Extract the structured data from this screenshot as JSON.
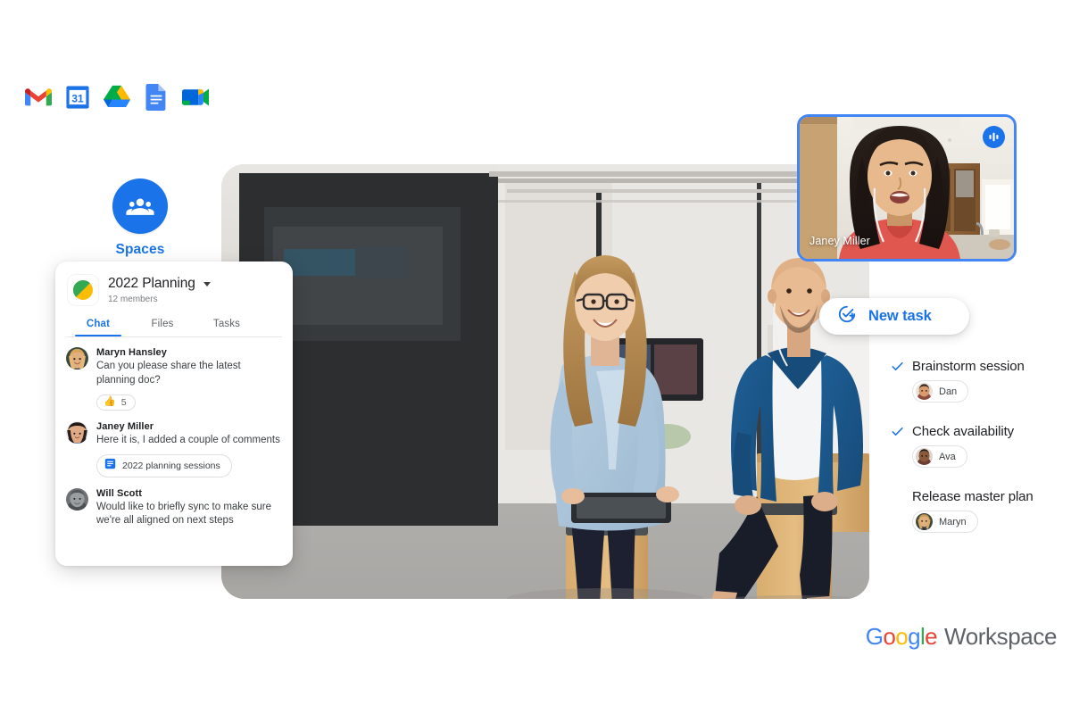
{
  "app_strip": {
    "icons": [
      {
        "name": "gmail-icon",
        "label": "Gmail"
      },
      {
        "name": "calendar-icon",
        "label": "Calendar",
        "day": "31"
      },
      {
        "name": "drive-icon",
        "label": "Drive"
      },
      {
        "name": "docs-icon",
        "label": "Docs"
      },
      {
        "name": "meet-icon",
        "label": "Meet"
      }
    ]
  },
  "spaces": {
    "label": "Spaces",
    "icon": "people-group-icon",
    "accent": "#1a73e8"
  },
  "chat_card": {
    "space_name": "2022 Planning",
    "members": "12 members",
    "avatar_icon": "space-avatar-icon",
    "dropdown_icon": "chevron-down-icon",
    "tabs": [
      {
        "label": "Chat",
        "active": true
      },
      {
        "label": "Files",
        "active": false
      },
      {
        "label": "Tasks",
        "active": false
      }
    ],
    "messages": [
      {
        "author": "Maryn Hansley",
        "text": "Can you please share the latest planning doc?",
        "reaction": {
          "emoji": "👍",
          "count": "5"
        }
      },
      {
        "author": "Janey Miller",
        "text": "Here it is, I added a couple of comments",
        "attachment": {
          "name": "2022 planning sessions",
          "icon": "google-docs-icon"
        }
      },
      {
        "author": "Will Scott",
        "text": "Would like to briefly sync to make sure we're all aligned on next steps"
      }
    ]
  },
  "video_tile": {
    "participant_name": "Janey Miller",
    "audio_icon": "audio-level-icon",
    "border_color": "#4285f4"
  },
  "new_task": {
    "label": "New task",
    "icon": "add-task-icon",
    "accent": "#1a73e8"
  },
  "tasks": [
    {
      "title": "Brainstorm session",
      "completed": true,
      "assignee": "Dan"
    },
    {
      "title": "Check availability",
      "completed": true,
      "assignee": "Ava"
    },
    {
      "title": "Release master plan",
      "completed": false,
      "assignee": "Maryn"
    }
  ],
  "branding": {
    "google_letters": [
      {
        "char": "G",
        "color": "#4285f4"
      },
      {
        "char": "o",
        "color": "#ea4335"
      },
      {
        "char": "o",
        "color": "#fbbc04"
      },
      {
        "char": "g",
        "color": "#4285f4"
      },
      {
        "char": "l",
        "color": "#34a853"
      },
      {
        "char": "e",
        "color": "#ea4335"
      }
    ],
    "product": "Workspace"
  }
}
